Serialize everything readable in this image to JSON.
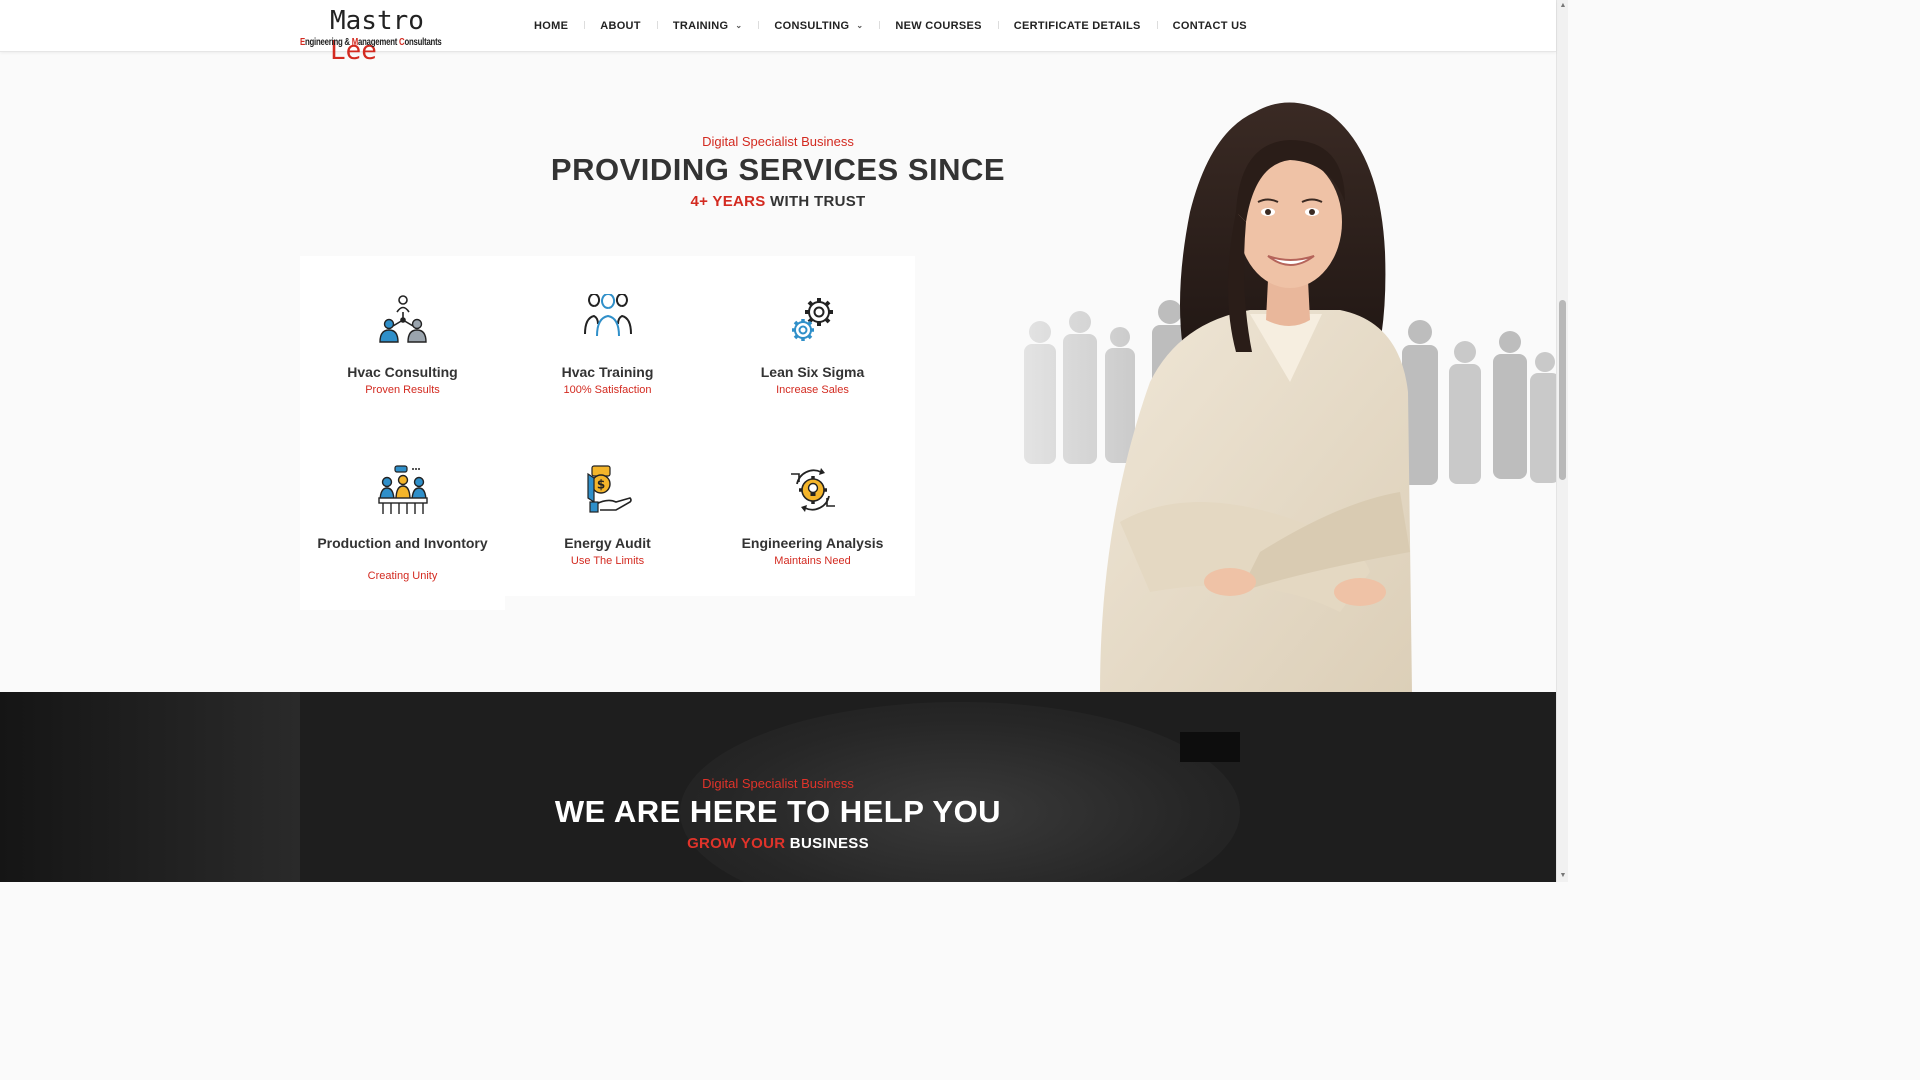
{
  "header": {
    "logo": {
      "name_first": "M",
      "name_rest": "astro ",
      "name_accent": "Lee",
      "tagline_parts": [
        "E",
        "ngineering & ",
        "M",
        "anagement ",
        "C",
        "onsultants"
      ]
    },
    "nav": [
      {
        "label": "HOME",
        "dropdown": false
      },
      {
        "label": "ABOUT",
        "dropdown": false
      },
      {
        "label": "TRAINING",
        "dropdown": true
      },
      {
        "label": "CONSULTING",
        "dropdown": true
      },
      {
        "label": "NEW COURSES",
        "dropdown": false
      },
      {
        "label": "CERTIFICATE DETAILS",
        "dropdown": false
      },
      {
        "label": "CONTACT US",
        "dropdown": false
      }
    ]
  },
  "services": {
    "kicker": "Digital Specialist Business",
    "title": "PROVIDING SERVICES SINCE",
    "sub_highlight": "4+ YEARS",
    "sub_rest": " WITH TRUST",
    "cards": [
      {
        "title": "Hvac Consulting",
        "subtitle": "Proven Results",
        "icon": "team-network-icon"
      },
      {
        "title": "Hvac Training",
        "subtitle": "100% Satisfaction",
        "icon": "group-people-icon"
      },
      {
        "title": "Lean Six Sigma",
        "subtitle": "Increase Sales",
        "icon": "gears-icon"
      },
      {
        "title": "Production and Invontory",
        "subtitle": "Creating Unity",
        "icon": "meeting-icon"
      },
      {
        "title": "Energy Audit",
        "subtitle": "Use The Limits",
        "icon": "money-hand-icon"
      },
      {
        "title": "Engineering Analysis",
        "subtitle": "Maintains Need",
        "icon": "idea-gear-icon"
      }
    ]
  },
  "help": {
    "kicker": "Digital Specialist Business",
    "title": "WE ARE HERE TO HELP YOU",
    "sub_highlight": "GROW YOUR",
    "sub_rest": " BUSINESS"
  },
  "colors": {
    "accent": "#d32a20",
    "icon_blue": "#2f8fc9",
    "icon_yellow": "#f4b52a",
    "dark_bg": "#1e1e1e"
  }
}
